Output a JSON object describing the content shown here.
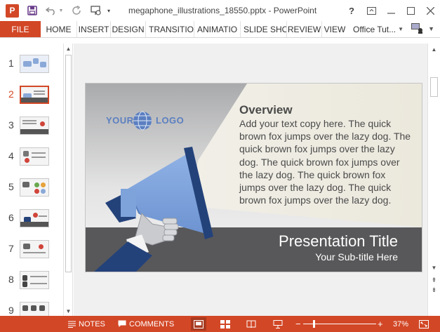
{
  "window": {
    "title": "megaphone_illustrations_18550.pptx - PowerPoint",
    "help_label": "?",
    "app_icon_letter": "P"
  },
  "ribbon": {
    "file": "FILE",
    "tabs": [
      "HOME",
      "INSERT",
      "DESIGN",
      "TRANSITIO",
      "ANIMATIO",
      "SLIDE SHO",
      "REVIEW",
      "VIEW"
    ],
    "account": "Office Tut..."
  },
  "thumbnails": {
    "numbers": [
      "1",
      "2",
      "3",
      "4",
      "5",
      "6",
      "7",
      "8",
      "9"
    ],
    "active_index": 2
  },
  "slide": {
    "heading": "Overview",
    "body": "Add your text copy here. The quick brown fox jumps over the lazy dog. The quick brown fox jumps over the lazy dog. The quick brown fox jumps over the lazy dog. The quick brown fox jumps over the lazy dog. The quick brown fox jumps over the lazy dog.",
    "title": "Presentation Title",
    "subtitle": "Your Sub-title Here",
    "logo_left": "YOUR",
    "logo_right": "LOGO"
  },
  "status": {
    "notes": "NOTES",
    "comments": "COMMENTS",
    "zoom_minus": "−",
    "zoom_plus": "+",
    "zoom": "37%"
  },
  "colors": {
    "accent": "#d24726",
    "megaphone_blue": "#7fa4db",
    "dark_navy": "#24427a",
    "title_band": "#58585a",
    "beam": "#efece2"
  }
}
